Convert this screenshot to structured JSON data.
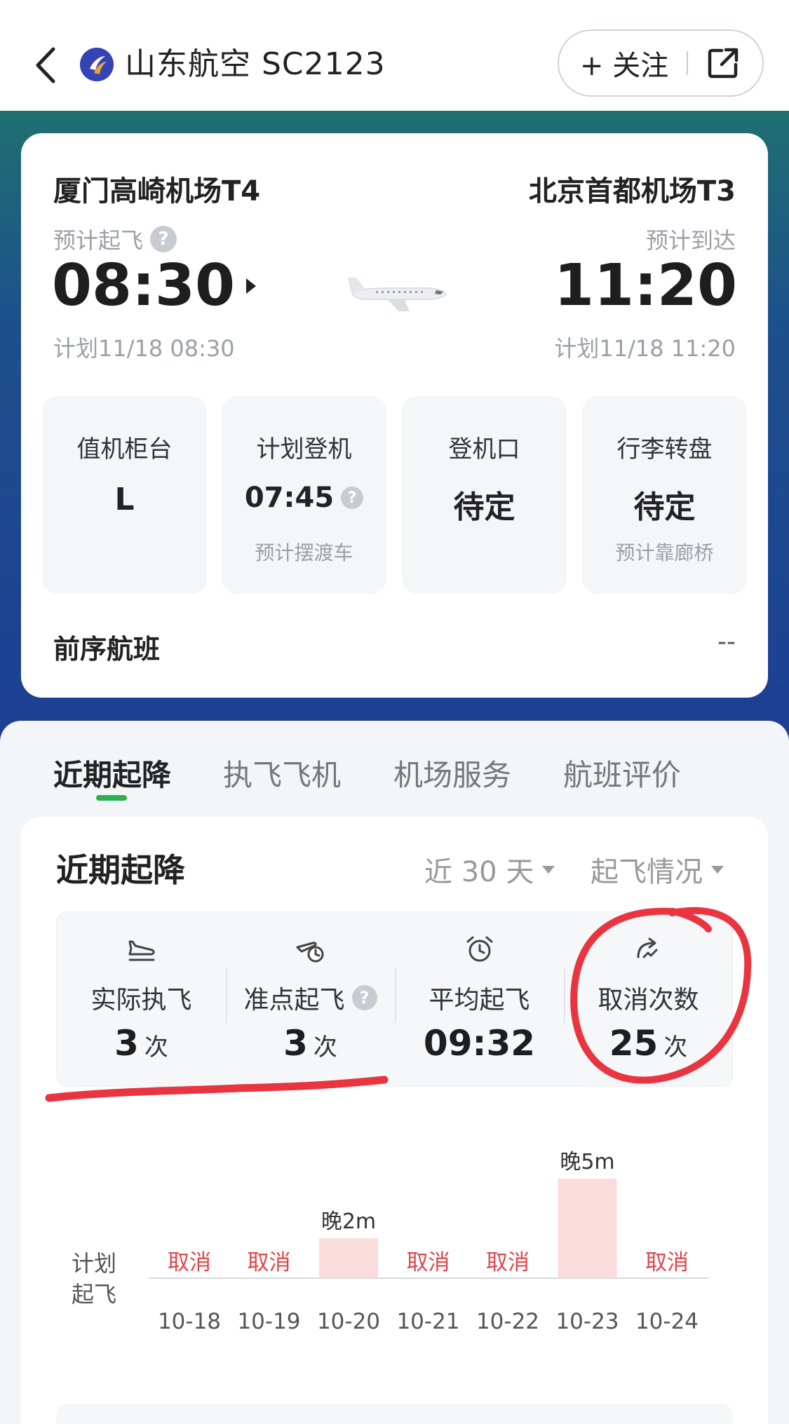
{
  "header": {
    "title": "山东航空 SC2123",
    "follow_label": "+ 关注"
  },
  "flight": {
    "departure": {
      "airport": "厦门高崎机场T4",
      "status_label": "预计起飞",
      "time": "08:30",
      "plan": "计划11/18 08:30"
    },
    "arrival": {
      "airport": "北京首都机场T3",
      "status_label": "预计到达",
      "time": "11:20",
      "plan": "计划11/18 11:20"
    },
    "tiles": [
      {
        "label": "值机柜台",
        "value": "L",
        "sub": ""
      },
      {
        "label": "计划登机",
        "value": "07:45",
        "sub": "预计摆渡车"
      },
      {
        "label": "登机口",
        "value": "待定",
        "sub": ""
      },
      {
        "label": "行李转盘",
        "value": "待定",
        "sub": "预计靠廊桥"
      }
    ],
    "previous": {
      "label": "前序航班",
      "value": "--"
    }
  },
  "tabs": [
    {
      "label": "近期起降",
      "active": true
    },
    {
      "label": "执飞飞机",
      "active": false
    },
    {
      "label": "机场服务",
      "active": false
    },
    {
      "label": "航班评价",
      "active": false
    }
  ],
  "recent": {
    "title": "近期起降",
    "range_label": "近 30 天",
    "mode_label": "起飞情况",
    "stats": [
      {
        "icon": "takeoff-icon",
        "label": "实际执飞",
        "value": "3",
        "unit": "次"
      },
      {
        "icon": "ontime-takeoff-icon",
        "label": "准点起飞",
        "value": "3",
        "unit": "次"
      },
      {
        "icon": "alarm-clock-icon",
        "label": "平均起飞",
        "value": "09:32",
        "unit": ""
      },
      {
        "icon": "return-arrow-icon",
        "label": "取消次数",
        "value": "25",
        "unit": "次"
      }
    ]
  },
  "chart_data": {
    "type": "bar",
    "ylabel": "计划\n起飞",
    "categories": [
      "10-18",
      "10-19",
      "10-20",
      "10-21",
      "10-22",
      "10-23",
      "10-24"
    ],
    "series": [
      {
        "values": [
          null,
          null,
          2,
          null,
          null,
          5,
          null
        ]
      }
    ],
    "data_labels": [
      "取消",
      "取消",
      "晚2m",
      "取消",
      "取消",
      "晚5m",
      "取消"
    ],
    "cancel_color": "#e0474c",
    "bar_color": "#fadcdc"
  },
  "colors": {
    "accent_green": "#2bb24c",
    "annotation_red": "#e8353f"
  }
}
